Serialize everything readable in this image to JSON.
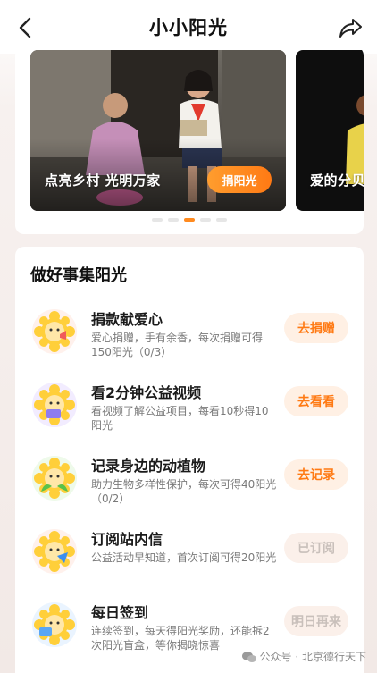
{
  "header": {
    "title": "小小阳光"
  },
  "banner": {
    "slides": [
      {
        "caption": "点亮乡村 光明万家",
        "button": "捐阳光"
      },
      {
        "caption": "爱的分贝"
      }
    ],
    "active_dot": 2
  },
  "tasks": {
    "title": "做好事集阳光",
    "items": [
      {
        "title": "捐款献爱心",
        "desc": "爱心捐赠，手有余香，每次捐赠可得150阳光（0/3）",
        "button": "去捐赠",
        "enabled": true
      },
      {
        "title": "看2分钟公益视频",
        "desc": "看视频了解公益项目，每看10秒得10阳光",
        "button": "去看看",
        "enabled": true
      },
      {
        "title": "记录身边的动植物",
        "desc": "助力生物多样性保护，每次可得40阳光（0/2）",
        "button": "去记录",
        "enabled": true
      },
      {
        "title": "订阅站内信",
        "desc": "公益活动早知道，首次订阅可得20阳光",
        "button": "已订阅",
        "enabled": false
      },
      {
        "title": "每日签到",
        "desc": "连续签到，每天得阳光奖励，还能拆2次阳光盲盒，等你揭晓惊喜",
        "button": "明日再来",
        "enabled": false
      }
    ]
  },
  "watermark": {
    "text": "公众号 · 北京德行天下"
  },
  "colors": {
    "accent": "#ff7a14",
    "accent_light": "#fff0e4"
  }
}
